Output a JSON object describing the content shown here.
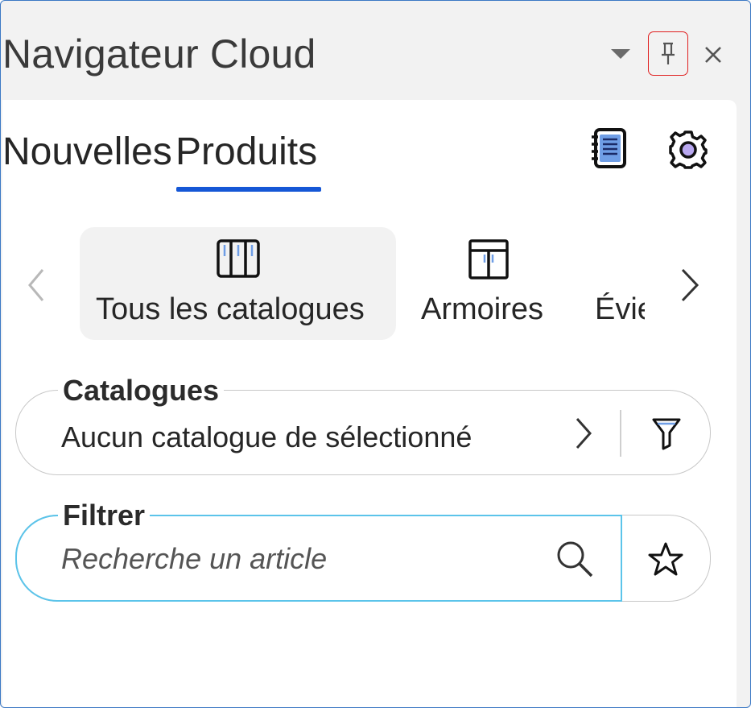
{
  "panel": {
    "title": "Navigateur Cloud",
    "controls": {
      "dropdown_icon": "chevron-down-icon",
      "pin_icon": "pin-icon",
      "close_icon": "close-icon"
    }
  },
  "tabs": [
    {
      "label": "Nouvelles",
      "active": false
    },
    {
      "label": "Produits",
      "active": true
    }
  ],
  "header_icons": [
    "catalog-book-icon",
    "gear-icon"
  ],
  "categories": {
    "items": [
      {
        "label": "Tous les catalogues",
        "icon": "catalogs-icon",
        "selected": true
      },
      {
        "label": "Armoires",
        "icon": "cabinet-icon",
        "selected": false
      },
      {
        "label": "Évie",
        "icon": "",
        "selected": false
      }
    ]
  },
  "catalog_field": {
    "legend": "Catalogues",
    "value": "Aucun catalogue de sélectionné"
  },
  "filter_field": {
    "legend": "Filtrer",
    "placeholder": "Recherche un article"
  },
  "colors": {
    "accent": "#1557d6",
    "focus_border": "#5bc4ea",
    "highlight_pin": "#e02020",
    "frame_border": "#3b78c4"
  }
}
